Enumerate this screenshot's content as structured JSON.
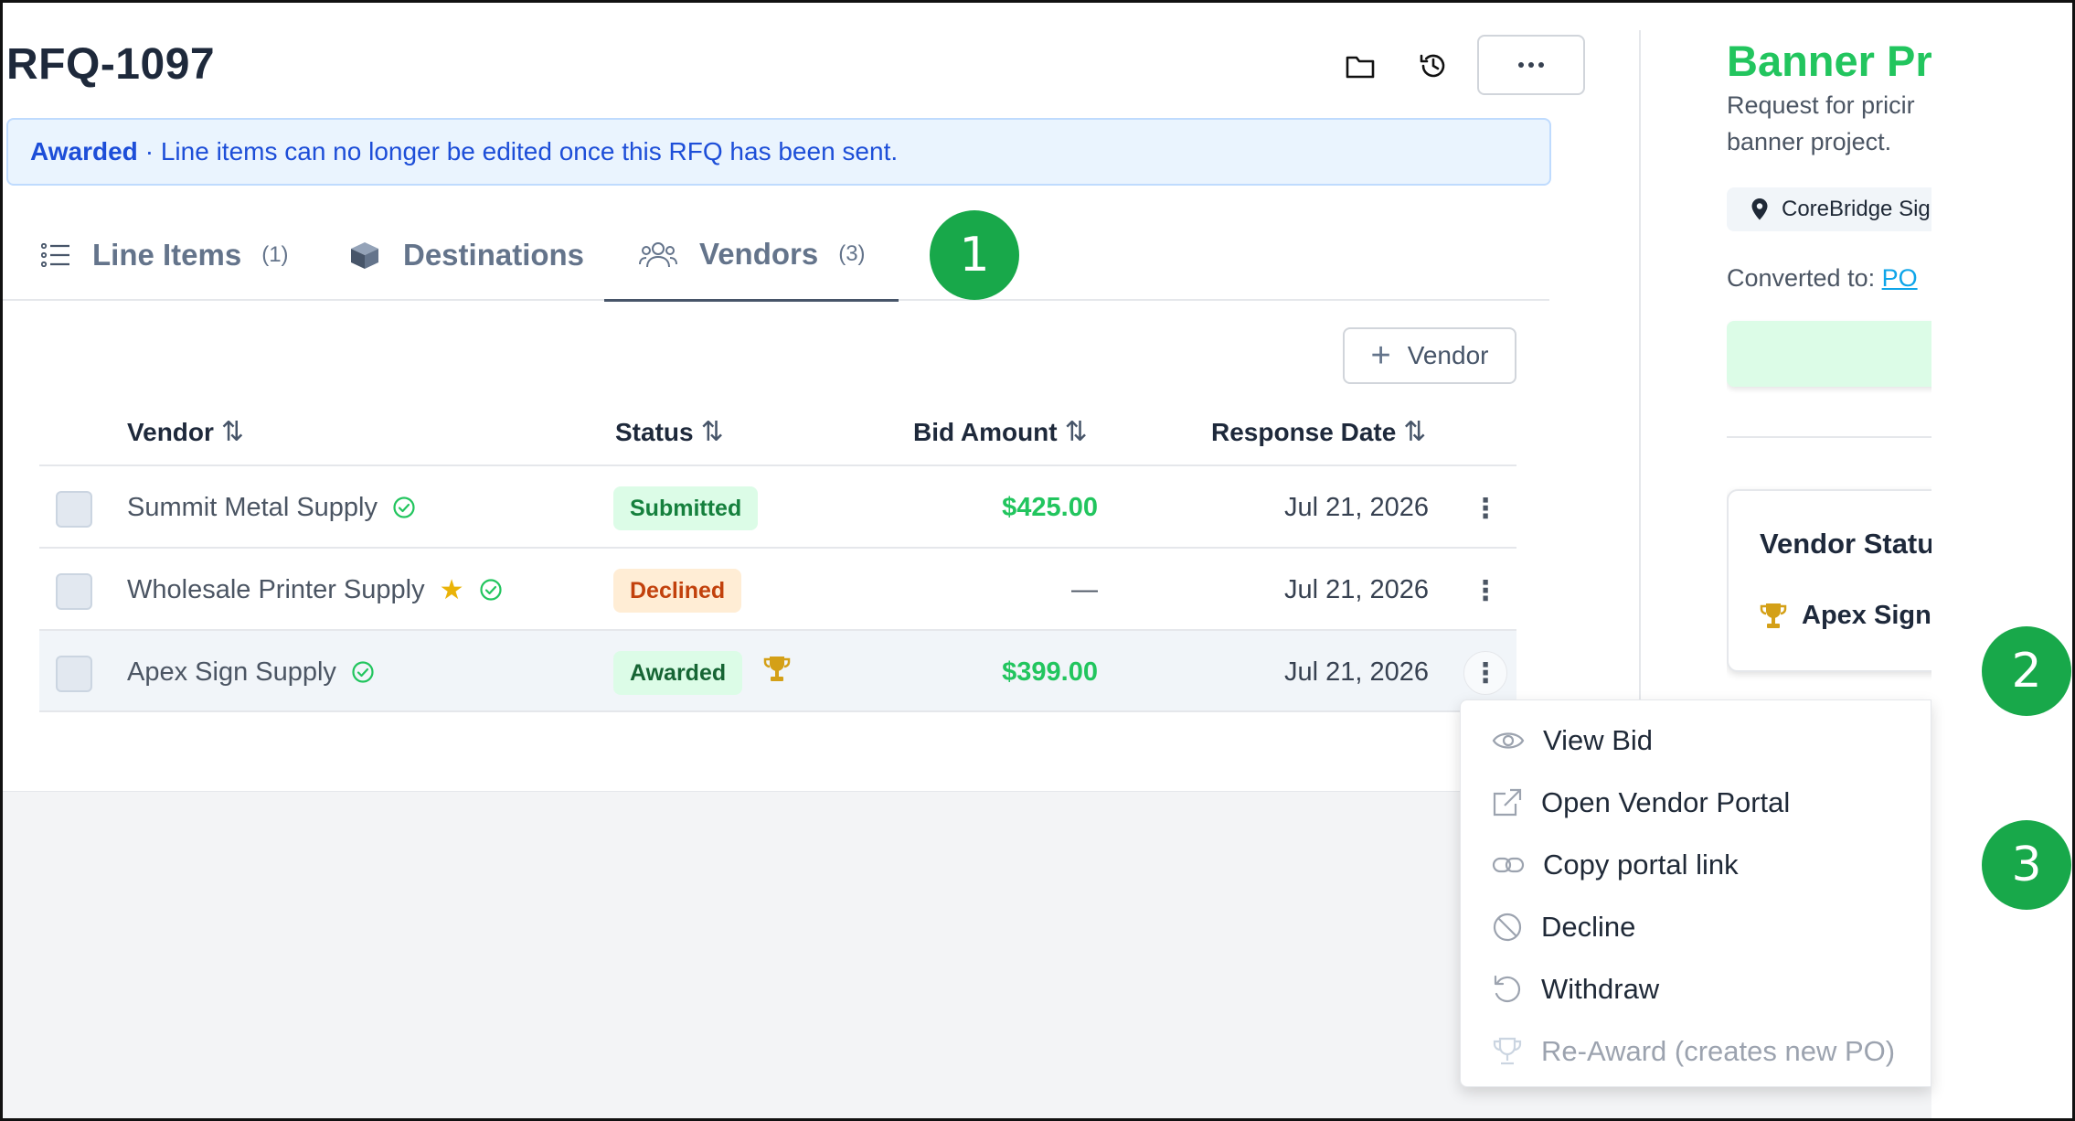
{
  "header": {
    "title": "RFQ-1097",
    "icons": [
      "folder-icon",
      "history-icon",
      "more-icon"
    ]
  },
  "banner": {
    "status": "Awarded",
    "message": "· Line items can no longer be edited once this RFQ has been sent."
  },
  "tabs": [
    {
      "label": "Line Items",
      "count": "(1)",
      "icon": "list-icon"
    },
    {
      "label": "Destinations",
      "count": "",
      "icon": "box-icon"
    },
    {
      "label": "Vendors",
      "count": "(3)",
      "icon": "users-icon",
      "active": true
    }
  ],
  "annotations": [
    "1",
    "2",
    "3"
  ],
  "toolbar": {
    "add_vendor_label": "Vendor"
  },
  "table": {
    "columns": [
      "Vendor",
      "Status",
      "Bid Amount",
      "Response Date"
    ],
    "rows": [
      {
        "vendor": "Summit Metal Supply",
        "preferred": false,
        "status": "Submitted",
        "status_kind": "submitted",
        "bid": "$425.00",
        "date": "Jul 21, 2026"
      },
      {
        "vendor": "Wholesale Printer Supply",
        "preferred": true,
        "status": "Declined",
        "status_kind": "declined",
        "bid": "—",
        "date": "Jul 21, 2026"
      },
      {
        "vendor": "Apex Sign Supply",
        "preferred": false,
        "status": "Awarded",
        "status_kind": "awarded",
        "bid": "$399.00",
        "date": "Jul 21, 2026",
        "selected": true
      }
    ]
  },
  "menu": {
    "items": [
      {
        "label": "View Bid",
        "icon": "eye-icon",
        "disabled": false
      },
      {
        "label": "Open Vendor Portal",
        "icon": "external-link-icon",
        "disabled": false
      },
      {
        "label": "Copy portal link",
        "icon": "link-icon",
        "disabled": false
      },
      {
        "label": "Decline",
        "icon": "ban-icon",
        "disabled": false
      },
      {
        "label": "Withdraw",
        "icon": "undo-icon",
        "disabled": false
      },
      {
        "label": "Re-Award (creates new PO)",
        "icon": "trophy-icon",
        "disabled": true
      }
    ]
  },
  "side": {
    "title": "Banner Pri",
    "description": "Request for pricir banner project.",
    "location": "CoreBridge Sig",
    "converted_label": "Converted to:",
    "converted_link": "PO",
    "card_title": "Vendor Statu",
    "card_value": "Apex Sign"
  },
  "colors": {
    "accent_green": "#22c55e",
    "badge_green": "#18a84a",
    "banner_blue": "#1d4ed8",
    "declined_orange": "#c2410c"
  }
}
